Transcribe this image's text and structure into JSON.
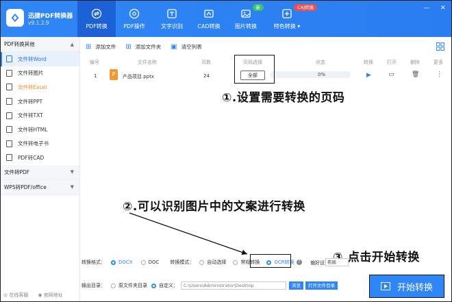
{
  "app": {
    "name": "迅捷PDF转换器",
    "version": "v9.1.2.9"
  },
  "nav": [
    {
      "label": "PDF转换",
      "icon": "convert-icon"
    },
    {
      "label": "PDF操作",
      "icon": "settings-icon"
    },
    {
      "label": "文字识别",
      "icon": "ocr-icon"
    },
    {
      "label": "CAD转换",
      "icon": "cad-icon"
    },
    {
      "label": "图片转换",
      "icon": "image-icon",
      "badge": "新"
    },
    {
      "label": "特色转换 ▾",
      "icon": "feature-icon",
      "badge": "CAJ转换"
    }
  ],
  "window_controls": {
    "minimize": "—",
    "close": "✕"
  },
  "sidebar": {
    "section1": "PDF转换其他",
    "items": [
      {
        "label": "文件转Word"
      },
      {
        "label": "文件转图片"
      },
      {
        "label": "文件转Excel"
      },
      {
        "label": "文件转PPT"
      },
      {
        "label": "文件转TXT"
      },
      {
        "label": "文件转HTML"
      },
      {
        "label": "文件转电子书"
      },
      {
        "label": "PDF转CAD"
      }
    ],
    "section2": "文件转PDF",
    "section3": "WPS转PDF/office",
    "footer_service": "在线客服",
    "footer_site": "官网地址"
  },
  "toolbar": {
    "add_file": "添加文件",
    "add_folder": "添加文件夹",
    "clear_list": "清空列表"
  },
  "table": {
    "headers": [
      "编号",
      "文件名称",
      "页数",
      "页码选择",
      "状态",
      "转换",
      "打开",
      "删除",
      "更多"
    ],
    "row": {
      "index": "1",
      "name": "产品项目.pptx",
      "pages": "24",
      "page_select": "全部",
      "progress": 0,
      "status": "0%"
    }
  },
  "annotations": {
    "a1": "①.设置需要转换的页码",
    "a2": "②.可以识别图片中的文案进行转换",
    "a3": "③.点击开始转换"
  },
  "options": {
    "format_label": "转换格式：",
    "docx": "DOCX",
    "doc": "DOC",
    "mode_label": "转换模式：",
    "auto": "自动选择",
    "normal": "常规转换",
    "ocr": "OCR转换",
    "layout_label": "偏好设置：",
    "layout_value": "布局"
  },
  "output": {
    "label": "输出目录：",
    "original": "原文件夹目录",
    "custom": "自定义：",
    "path": "C:\\Users\\Administrator\\Desktop",
    "browse": "浏览",
    "open_folder": "打开文件目录"
  },
  "start_button": "开始转换"
}
